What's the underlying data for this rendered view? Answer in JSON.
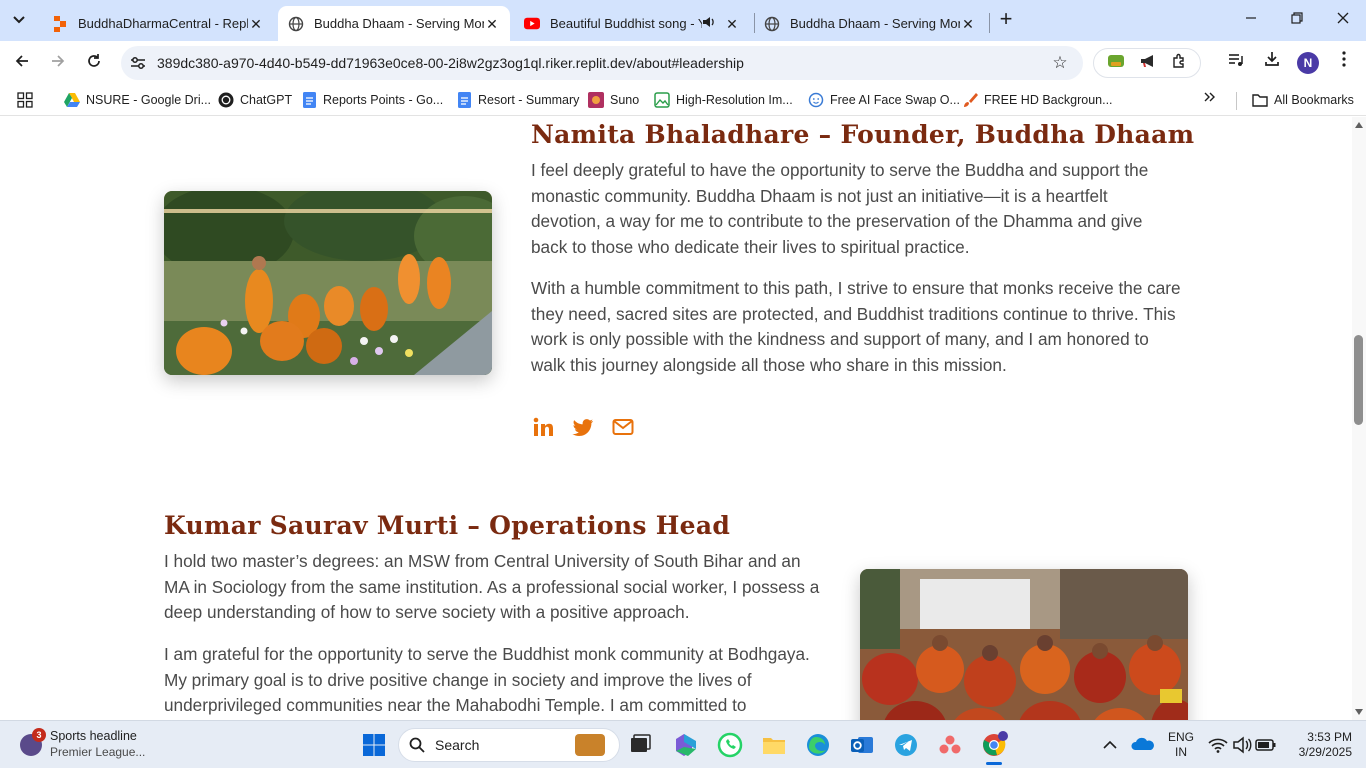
{
  "tabs": [
    {
      "title": "BuddhaDharmaCentral - Replit",
      "close": "✕"
    },
    {
      "title": "Buddha Dhaam - Serving Monk",
      "close": "✕"
    },
    {
      "title": "Beautiful Buddhist song - Yo",
      "close": "✕"
    },
    {
      "title": "Buddha Dhaam - Serving Monk",
      "close": "✕"
    }
  ],
  "toolbar": {
    "url": "389dc380-a970-4d40-b549-dd71963e0ce8-00-2i8w2gz3og1ql.riker.replit.dev/about#leadership",
    "profile_initial": "N"
  },
  "bookmarks": [
    {
      "label": "NSURE - Google Dri...",
      "icon": "google-drive-icon"
    },
    {
      "label": "ChatGPT",
      "icon": "chatgpt-icon"
    },
    {
      "label": "Reports Points - Go...",
      "icon": "google-docs-icon"
    },
    {
      "label": "Resort - Summary",
      "icon": "google-docs-icon"
    },
    {
      "label": "Suno",
      "icon": "suno-icon"
    },
    {
      "label": "High-Resolution Im...",
      "icon": "image-icon"
    },
    {
      "label": "Free AI Face Swap O...",
      "icon": "face-swap-icon"
    },
    {
      "label": "FREE HD Backgroun...",
      "icon": "brush-icon"
    }
  ],
  "all_bookmarks_label": "All Bookmarks",
  "sections": [
    {
      "heading": "Namita Bhaladhare – Founder, Buddha Dhaam",
      "paragraphs": [
        "I feel deeply grateful to have the opportunity to serve the Buddha and support the monastic community. Buddha Dhaam is not just an initiative—it is a heartfelt devotion, a way for me to contribute to the preservation of the Dhamma and give back to those who dedicate their lives to spiritual practice.",
        "With a humble commitment to this path, I strive to ensure that monks receive the care they need, sacred sites are protected, and Buddhist traditions continue to thrive. This work is only possible with the kindness and support of many, and I am honored to walk this journey alongside all those who share in this mission."
      ]
    },
    {
      "heading": "Kumar Saurav Murti – Operations Head",
      "paragraphs": [
        "I hold two master’s degrees: an MSW from Central University of South Bihar and an MA in Sociology from the same institution. As a professional social worker, I possess a deep understanding of how to serve society with a positive approach.",
        "I am grateful for the opportunity to serve the Buddhist monk community at Bodhgaya. My primary goal is to drive positive change in society and improve the lives of underprivileged communities near the Mahabodhi Temple. I am committed to"
      ]
    }
  ],
  "colors": {
    "heading": "#7a2a10",
    "social_icon": "#e8720c",
    "body_text": "#4a4a4a"
  },
  "taskbar": {
    "news_badge": "3",
    "news_title": "Sports headline",
    "news_subtitle": "Premier League...",
    "search_label": "Search",
    "lang_top": "ENG",
    "lang_bottom": "IN",
    "time": "3:53 PM",
    "date": "3/29/2025"
  }
}
